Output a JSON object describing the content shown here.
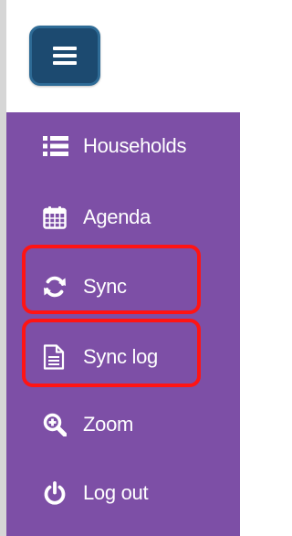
{
  "menu_toggle": {
    "icon": "hamburger-icon"
  },
  "nav": {
    "items": [
      {
        "label": "Households",
        "icon": "list-icon"
      },
      {
        "label": "Agenda",
        "icon": "calendar-icon"
      },
      {
        "label": "Sync",
        "icon": "refresh-icon"
      },
      {
        "label": "Sync log",
        "icon": "document-icon"
      },
      {
        "label": "Zoom",
        "icon": "zoom-in-icon"
      },
      {
        "label": "Log out",
        "icon": "power-icon"
      }
    ],
    "highlighted": [
      "Sync",
      "Sync log"
    ]
  },
  "colors": {
    "sidebar_bg": "#7d4fa6",
    "button_bg": "#1c4a70",
    "highlight": "#ff1414",
    "text": "#ffffff"
  }
}
